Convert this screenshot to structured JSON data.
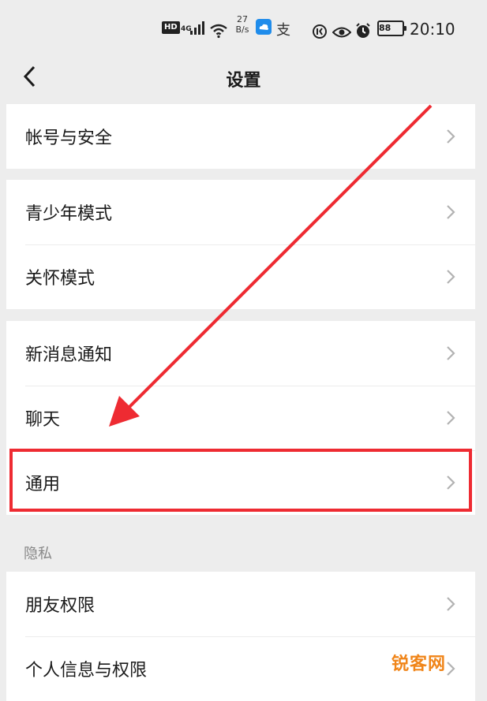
{
  "status_bar": {
    "hd": "HD",
    "network": "4G",
    "speed_value": "27",
    "speed_unit": "B/s",
    "battery": "88",
    "time": "20:10",
    "alipay_glyph": "支"
  },
  "nav": {
    "title": "设置",
    "back_icon": "chevron-left-icon"
  },
  "groups": [
    {
      "items": [
        {
          "label": "帐号与安全"
        }
      ]
    },
    {
      "items": [
        {
          "label": "青少年模式"
        },
        {
          "label": "关怀模式"
        }
      ]
    },
    {
      "items": [
        {
          "label": "新消息通知"
        },
        {
          "label": "聊天"
        },
        {
          "label": "通用"
        }
      ]
    },
    {
      "section_title": "隐私",
      "items": [
        {
          "label": "朋友权限"
        },
        {
          "label": "个人信息与权限"
        }
      ]
    }
  ],
  "annotation": {
    "highlight_color": "#ee2b32",
    "highlighted_item": "通用"
  },
  "watermark": "锐客网",
  "colors": {
    "background": "#ededed",
    "card": "#ffffff",
    "accent": "#ee2b32",
    "watermark": "#f08519"
  }
}
